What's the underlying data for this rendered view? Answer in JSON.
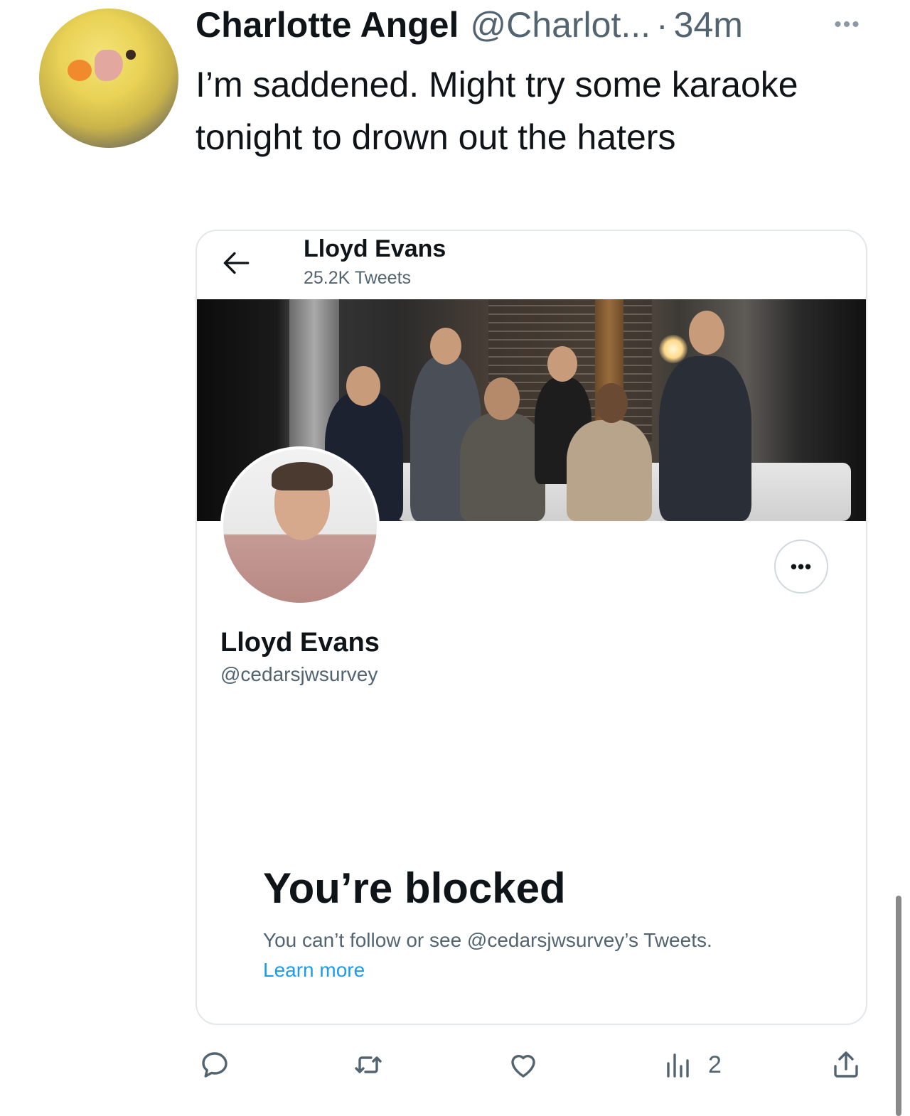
{
  "tweet": {
    "author": {
      "display_name": "Charlotte Angel",
      "handle": "@Charlot...",
      "separator": "·",
      "timestamp": "34m",
      "avatar": "bird-avatar-icon"
    },
    "more_label": "•••",
    "text": "I’m saddened.  Might try some karaoke tonight to drown out the haters"
  },
  "card": {
    "header": {
      "back_icon": "arrow-left-icon",
      "title": "Lloyd Evans",
      "subtitle": "25.2K Tweets"
    },
    "profile": {
      "more_label": "•••",
      "name": "Lloyd Evans",
      "handle": "@cedarsjwsurvey"
    },
    "blocked": {
      "title": "You’re blocked",
      "description": "You can’t follow or see @cedarsjwsurvey’s Tweets.",
      "learn_more": "Learn more"
    }
  },
  "actions": {
    "reply_icon": "reply-icon",
    "retweet_icon": "retweet-icon",
    "like_icon": "heart-icon",
    "views_icon": "views-icon",
    "views_count": "2",
    "share_icon": "share-icon"
  },
  "colors": {
    "text_primary": "#0f1419",
    "text_secondary": "#536471",
    "link": "#1d9bf0",
    "border": "#e3e7ea"
  }
}
